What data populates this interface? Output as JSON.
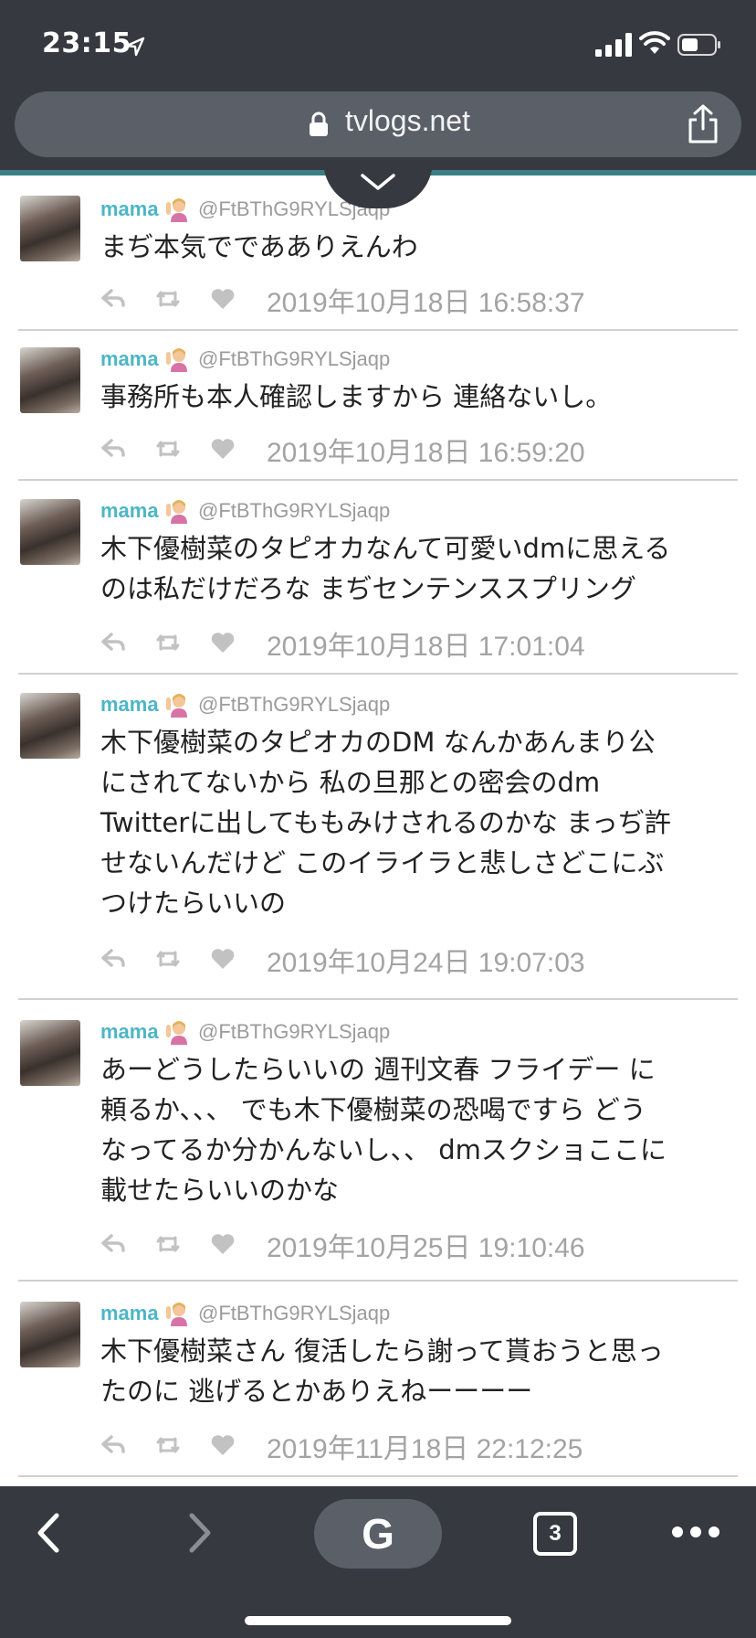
{
  "status_bar": {
    "time": "23:15"
  },
  "browser": {
    "url": "tvlogs.net"
  },
  "tweets": [
    {
      "name": "mama",
      "handle": "@FtBThG9RYLSjaqp",
      "lines": [
        "まぢ本気でであありえんわ"
      ],
      "timestamp": "2019年10月18日 16:58:37"
    },
    {
      "name": "mama",
      "handle": "@FtBThG9RYLSjaqp",
      "lines": [
        "事務所も本人確認しますから 連絡ないし。"
      ],
      "timestamp": "2019年10月18日 16:59:20"
    },
    {
      "name": "mama",
      "handle": "@FtBThG9RYLSjaqp",
      "lines": [
        "木下優樹菜のタピオカなんて可愛いdmに思える",
        "のは私だけだろな まぢセンテンススプリング"
      ],
      "timestamp": "2019年10月18日 17:01:04"
    },
    {
      "name": "mama",
      "handle": "@FtBThG9RYLSjaqp",
      "lines": [
        "木下優樹菜のタピオカのDM なんかあんまり公",
        "にされてないから 私の旦那との密会のdm",
        "Twitterに出してももみけされるのかな まっぢ許",
        "せないんだけど このイライラと悲しさどこにぶ",
        "つけたらいいの"
      ],
      "timestamp": "2019年10月24日 19:07:03"
    },
    {
      "name": "mama",
      "handle": "@FtBThG9RYLSjaqp",
      "lines": [
        "あーどうしたらいいの 週刊文春 フライデー に",
        "頼るか、、、 でも木下優樹菜の恐喝ですら どう",
        "なってるか分かんないし、、 dmスクショここに",
        "載せたらいいのかな"
      ],
      "timestamp": "2019年10月25日 19:10:46"
    },
    {
      "name": "mama",
      "handle": "@FtBThG9RYLSjaqp",
      "lines": [
        "木下優樹菜さん 復活したら謝って貰おうと思っ",
        "たのに 逃げるとかありえねーーーー"
      ],
      "timestamp": "2019年11月18日 22:12:25"
    }
  ],
  "toolbar": {
    "google_label": "G",
    "tab_count": "3"
  },
  "colors": {
    "chrome": "#363940",
    "pill": "#5b6068",
    "username": "#4cb6c6",
    "accent_line": "#3b7f86"
  },
  "icons": [
    "location-arrow-icon",
    "signal-icon",
    "wifi-icon",
    "battery-icon",
    "lock-icon",
    "share-icon",
    "chevron-down-icon",
    "reply-icon",
    "retweet-icon",
    "heart-icon",
    "woman-gesturing-emoji-icon",
    "back-icon",
    "forward-icon",
    "more-icon"
  ]
}
